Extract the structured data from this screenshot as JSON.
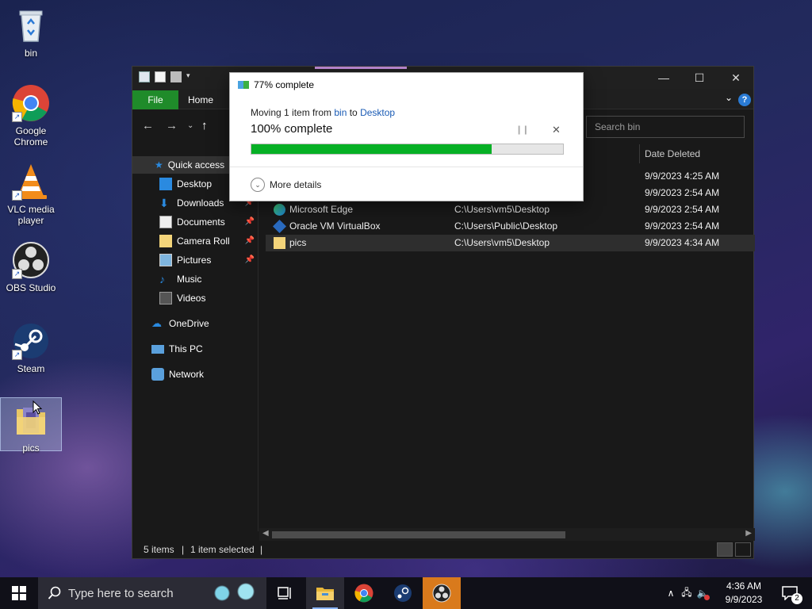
{
  "desktop": {
    "icons": [
      {
        "label": "bin"
      },
      {
        "label": "Google Chrome"
      },
      {
        "label": "VLC media player"
      },
      {
        "label": "OBS Studio"
      },
      {
        "label": "Steam"
      },
      {
        "label": "pics"
      }
    ]
  },
  "explorer": {
    "ribbon": {
      "file_tab": "File",
      "home_tab": "Home"
    },
    "search_placeholder": "Search bin",
    "nav": {
      "quick_access": "Quick access",
      "desktop": "Desktop",
      "downloads": "Downloads",
      "documents": "Documents",
      "camera_roll": "Camera Roll",
      "pictures": "Pictures",
      "music": "Music",
      "videos": "Videos",
      "onedrive": "OneDrive",
      "this_pc": "This PC",
      "network": "Network"
    },
    "columns": {
      "date_deleted": "Date Deleted"
    },
    "rows": [
      {
        "name": "",
        "location": "",
        "date": "9/9/2023 4:25 AM"
      },
      {
        "name": "",
        "location": "",
        "date": "9/9/2023 2:54 AM"
      },
      {
        "name": "Microsoft Edge",
        "location": "C:\\Users\\vm5\\Desktop",
        "date": "9/9/2023 2:54 AM"
      },
      {
        "name": "Oracle VM VirtualBox",
        "location": "C:\\Users\\Public\\Desktop",
        "date": "9/9/2023 2:54 AM"
      },
      {
        "name": "pics",
        "location": "C:\\Users\\vm5\\Desktop",
        "date": "9/9/2023 4:34 AM"
      }
    ],
    "status": {
      "items": "5 items",
      "selected": "1 item selected"
    }
  },
  "dialog": {
    "title": "77% complete",
    "moving_prefix": "Moving 1 item from ",
    "source": "bin",
    "to_word": " to ",
    "destination": "Desktop",
    "percent_text": "100% complete",
    "progress": 0.77,
    "more_details": "More details"
  },
  "taskbar": {
    "search_placeholder": "Type here to search",
    "time": "4:36 AM",
    "date": "9/9/2023",
    "notification_count": "2"
  },
  "colors": {
    "progress_fill": "#06b025",
    "file_tab": "#1f8b2a",
    "link": "#1a5bb5"
  }
}
